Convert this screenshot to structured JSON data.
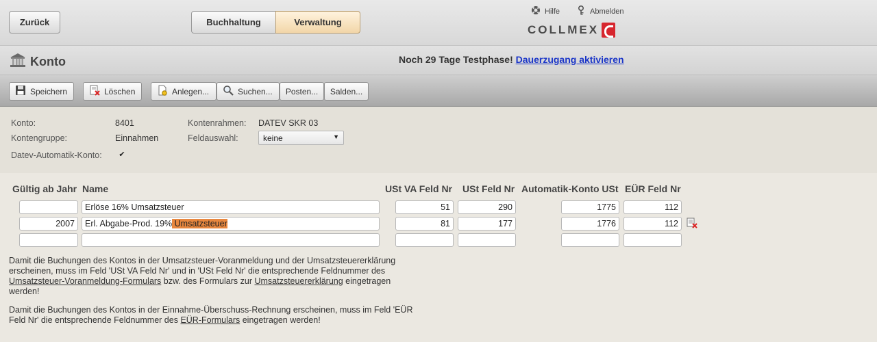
{
  "header": {
    "back_label": "Zurück",
    "tabs": [
      {
        "label": "Buchhaltung",
        "active": false
      },
      {
        "label": "Verwaltung",
        "active": true
      }
    ],
    "help_label": "Hilfe",
    "logout_label": "Abmelden",
    "logo_text": "COLLMEX"
  },
  "page": {
    "title": "Konto",
    "notice_text": "Noch 29 Tage Testphase!",
    "notice_link": "Dauerzugang aktivieren"
  },
  "toolbar": {
    "save": "Speichern",
    "delete": "Löschen",
    "create": "Anlegen...",
    "search": "Suchen...",
    "posts": "Posten...",
    "balances": "Salden..."
  },
  "account": {
    "konto_label": "Konto:",
    "konto_value": "8401",
    "kontengruppe_label": "Kontengruppe:",
    "kontengruppe_value": "Einnahmen",
    "kontenrahmen_label": "Kontenrahmen:",
    "kontenrahmen_value": "DATEV SKR 03",
    "feldauswahl_label": "Feldauswahl:",
    "feldauswahl_value": "keine",
    "datev_label": "Datev-Automatik-Konto:",
    "datev_checked": true
  },
  "table": {
    "headers": [
      "Gültig ab Jahr",
      "Name",
      "USt VA Feld Nr",
      "USt Feld Nr",
      "Automatik-Konto USt",
      "EÜR Feld Nr"
    ],
    "rows": [
      {
        "year": "",
        "name": "Erlöse 16% Umsatzsteuer",
        "name_highlight": "",
        "ust_va": "51",
        "ust": "290",
        "auto_konto": "1775",
        "eur": "112"
      },
      {
        "year": "2007",
        "name": "Erl. Abgabe-Prod. 19%",
        "name_highlight": " Umsatzsteuer",
        "ust_va": "81",
        "ust": "177",
        "auto_konto": "1776",
        "eur": "112"
      },
      {
        "year": "",
        "name": "",
        "name_highlight": "",
        "ust_va": "",
        "ust": "",
        "auto_konto": "",
        "eur": ""
      }
    ]
  },
  "info": {
    "p1_a": "Damit die Buchungen des Kontos in der Umsatzsteuer-Voranmeldung und der Umsatzsteuererklärung erscheinen, muss im Feld 'USt VA Feld Nr' und in 'USt Feld Nr' die entsprechende Feldnummer des ",
    "p1_link1": "Umsatzsteuer-Voranmeldung-Formulars",
    "p1_b": " bzw. des Formulars zur ",
    "p1_link2": "Umsatzsteuererklärung",
    "p1_c": " eingetragen werden!",
    "p2_a": "Damit die Buchungen des Kontos in der Einnahme-Überschuss-Rechnung erscheinen, muss im Feld 'EÜR Feld Nr' die entsprechende Feldnummer des ",
    "p2_link": "EÜR-Formulars",
    "p2_b": " eingetragen werden!"
  }
}
